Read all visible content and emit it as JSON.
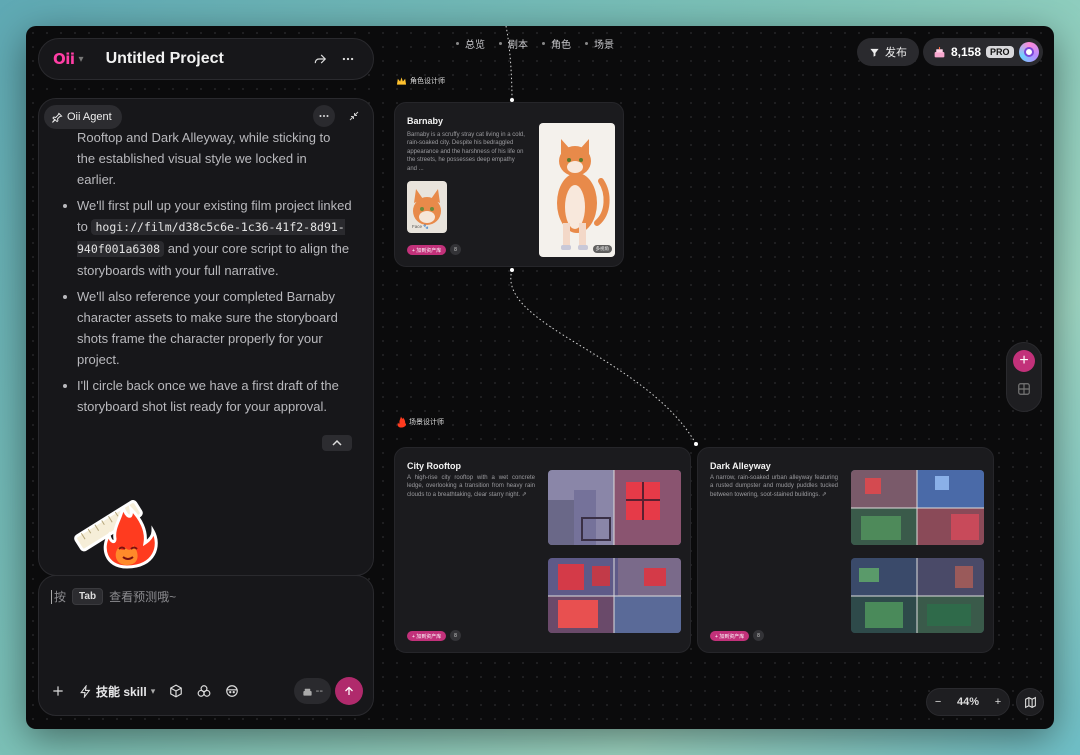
{
  "project": {
    "logo": "Oii",
    "title": "Untitled Project"
  },
  "agent": {
    "chip_label": "Oii Agent",
    "intro_line1": "Rooftop and Dark Alleyway, while sticking to",
    "intro_line2": "the established visual style we locked in",
    "intro_line3": "earlier.",
    "bullet1_a": "We'll first pull up your existing film project linked to ",
    "bullet1_code": "hogi://film/d38c5c6e-1c36-41f2-8d91-940f001a6308",
    "bullet1_b": " and your core script to align the storyboards with your full narrative.",
    "bullet2": "We'll also reference your completed Barnaby character assets to make sure the storyboard shots frame the character properly for your project.",
    "bullet3": "I'll circle back once we have a first draft of the storyboard shot list ready for your approval."
  },
  "input": {
    "hint_prefix": "按",
    "hint_key": "Tab",
    "hint_suffix": "查看预测哦~",
    "skill_label": "技能 skill",
    "credits_placeholder": "--"
  },
  "tabs": [
    "总览",
    "剧本",
    "角色",
    "场景"
  ],
  "header": {
    "publish_label": "发布",
    "credits": "8,158",
    "plan": "PRO"
  },
  "character_section": {
    "label": "角色设计师",
    "node": {
      "title": "Barnaby",
      "description": "Barnaby is a scruffy stray cat living in a cold, rain-soaked city. Despite his bedraggled appearance and the harshness of his life on the streets, he possesses deep empathy and ...",
      "thumb_caption": "Face 🐾",
      "image_badge": "多视角",
      "tag": "+ 加到资产库",
      "count": "8"
    }
  },
  "scene_section": {
    "label": "场景设计师",
    "nodes": [
      {
        "title": "City Rooftop",
        "description": "A high-rise city rooftop with a wet concrete ledge, overlooking a transition from heavy rain clouds to a breathtaking, clear starry night. ⇗",
        "tag": "+ 加到资产库",
        "count": "8"
      },
      {
        "title": "Dark Alleyway",
        "description": "A narrow, rain-soaked urban alleyway featuring a rusted dumpster and muddy puddles tucked between towering, soot-stained buildings. ⇗",
        "tag": "+ 加到资产库",
        "count": "8"
      }
    ]
  },
  "zoom": {
    "level": "44%"
  },
  "colors": {
    "accent": "#c2317a",
    "logo": "#ff3ea5",
    "canvas": "#0b0b0c"
  }
}
